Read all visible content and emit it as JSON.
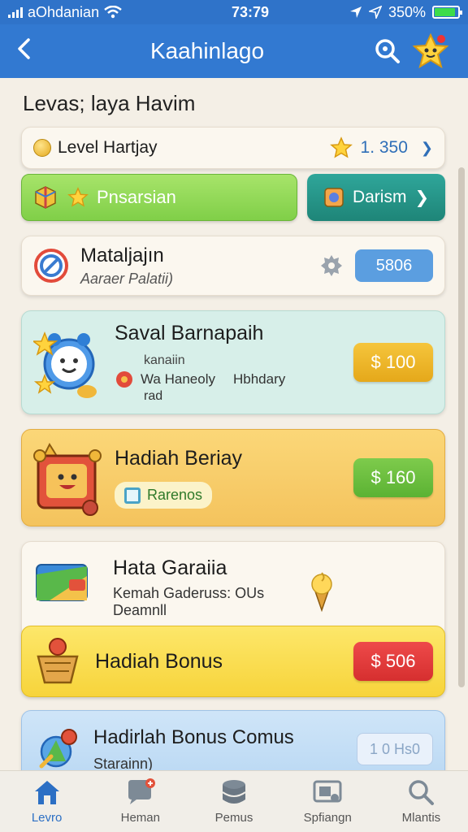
{
  "status": {
    "carrier": "aOhdanian",
    "time": "73:79",
    "battery": "350%",
    "battery_level": 0.9
  },
  "appbar": {
    "title": "Kaahinlago",
    "back_icon": "back-arrow-icon",
    "search_icon": "search-icon",
    "avatar_icon": "star-avatar-icon"
  },
  "section": {
    "title": "Levas; laya Havim"
  },
  "level_row": {
    "label": "Level Hartjay",
    "points": "1. 350"
  },
  "actions": {
    "primary": "Pnsarsian",
    "secondary": "Darism"
  },
  "task": {
    "title": "Mataljajın",
    "subtitle": "Aaraer Palatii)",
    "value": "5806"
  },
  "reward": {
    "title": "Saval Barnapaih",
    "line1": "kanaiin",
    "line2": "Wa Haneoly",
    "line3": "Hbhdary",
    "line4": "rad",
    "price": "$ 100"
  },
  "daily": {
    "title": "Hadiah Beriay",
    "tag": "Rarenos",
    "price": "$ 160"
  },
  "gift": {
    "title": "Hata Garaiia",
    "line1": "Kemah Gaderuss: OUs",
    "line2": "Deamnll"
  },
  "bonus": {
    "title": "Hadiah Bonus",
    "price": "$ 506"
  },
  "combo": {
    "title": "Hadirlah Bonus Comus",
    "subtitle": "Starainn)",
    "value": "1 0 Hs0"
  },
  "tabs": [
    {
      "label": "Levro",
      "icon": "home-icon"
    },
    {
      "label": "Heman",
      "icon": "chat-icon"
    },
    {
      "label": "Pemus",
      "icon": "database-icon"
    },
    {
      "label": "Spfiangn",
      "icon": "screen-icon"
    },
    {
      "label": "Mlantis",
      "icon": "search-icon"
    }
  ],
  "colors": {
    "primary": "#3279d1",
    "green": "#80cf48",
    "teal": "#1e8578",
    "orange": "#e5a81a",
    "red": "#d62f2f"
  }
}
